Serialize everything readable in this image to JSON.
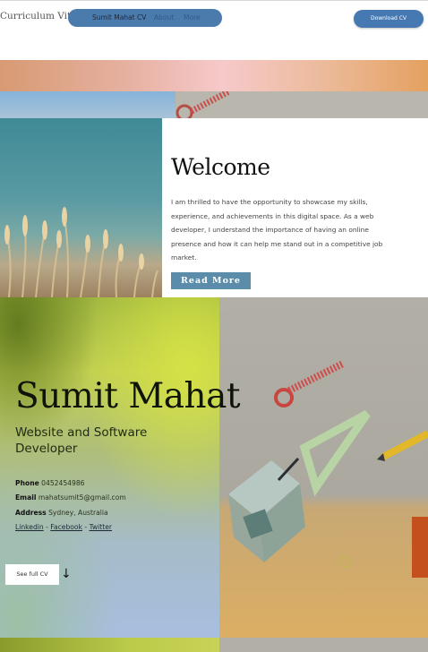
{
  "header": {
    "brand": "Curriculum Vitae",
    "nav": {
      "cv": "Sumit Mahat CV",
      "about": "About",
      "more": "More"
    },
    "download_label": "Download CV"
  },
  "welcome": {
    "title": "Welcome",
    "text": "I am thrilled to have the opportunity to showcase my skills, experience, and achievements in this digital space. As a web developer, I understand the importance of having an online presence and how it can help me stand out in a competitive job market.",
    "read_more": "Read More"
  },
  "hero": {
    "name": "Sumit Mahat",
    "subtitle": "Website and Software Developer",
    "phone_label": "Phone",
    "phone": "0452454986",
    "email_label": "Email",
    "email": "mahatsumit5@gmail.com",
    "address_label": "Address",
    "address": "Sydney, Australia",
    "links": [
      "Linkedin",
      "Facebook",
      "Twitter"
    ],
    "link_separator": "-",
    "see_full": "See full CV",
    "arrow": "↓"
  },
  "colors": {
    "accent": "#4b7aad",
    "button": "#5b8dab",
    "hero_green": "#c2cf52",
    "hero_blue": "#a7bee0"
  }
}
